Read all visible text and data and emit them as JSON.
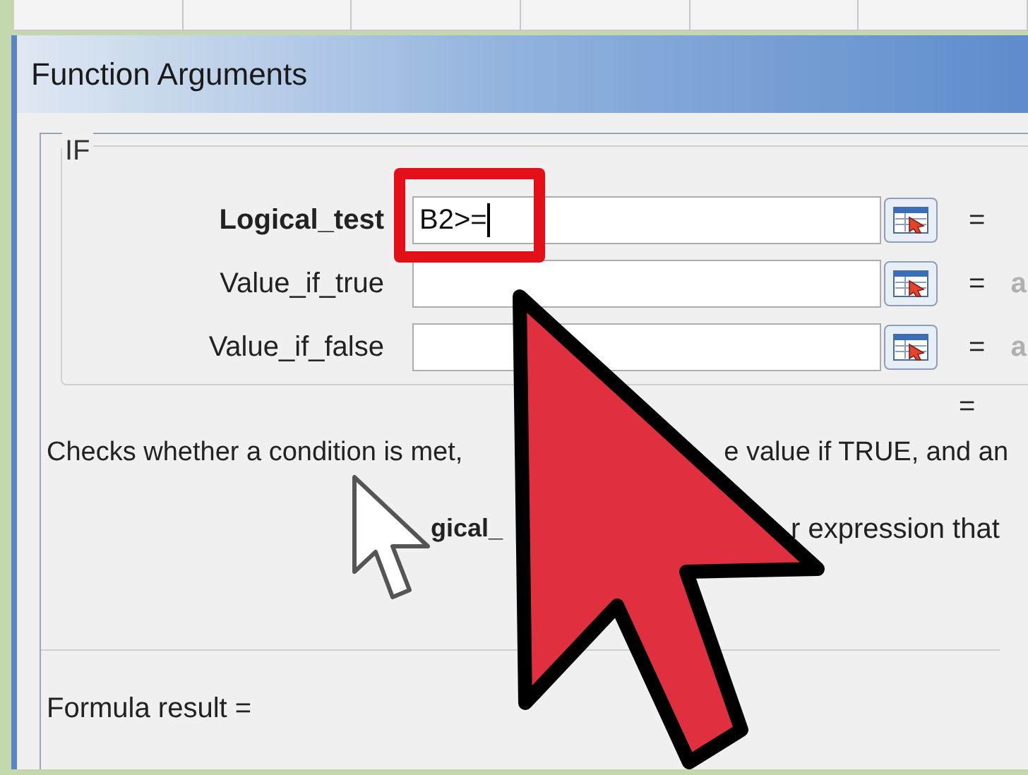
{
  "window": {
    "title": "Function Arguments"
  },
  "function_name": "IF",
  "arguments": [
    {
      "label": "Logical_test",
      "selected": true,
      "value": "B2>=",
      "equals": "="
    },
    {
      "label": "Value_if_true",
      "selected": false,
      "equals": "=",
      "result": "a"
    },
    {
      "label": "Value_if_false",
      "selected": false,
      "equals": "=",
      "result": "a"
    }
  ],
  "overall_equals": "=",
  "description_parts": [
    "Checks whether a condition is met,",
    "e value if TRUE, and an"
  ],
  "argument_help_parts": [
    "gical_",
    "r expression that"
  ],
  "formula_result": "Formula result ="
}
